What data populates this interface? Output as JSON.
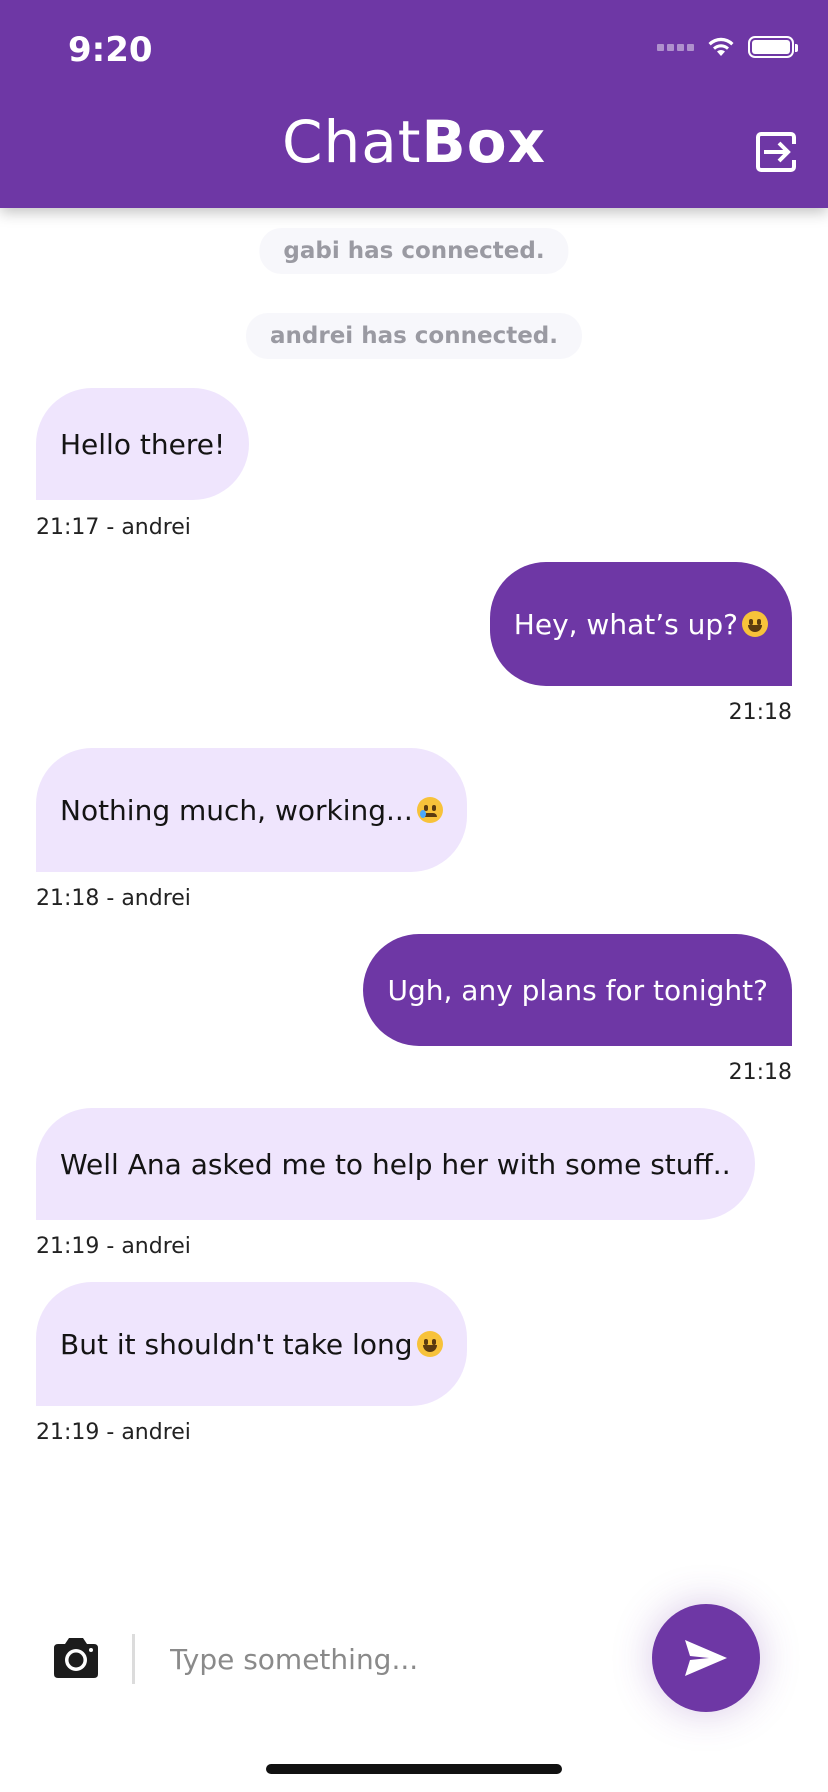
{
  "status_bar": {
    "time": "9:20"
  },
  "header": {
    "title_light": "Chat",
    "title_bold": "Box"
  },
  "system_messages": [
    {
      "text": "gabi has connected."
    },
    {
      "text": "andrei has connected."
    }
  ],
  "messages": [
    {
      "text": "Hello there!",
      "meta": "21:17 - andrei",
      "emoji": null
    },
    {
      "text": "Hey, what’s up?",
      "meta": "21:18",
      "emoji": "grinning-face"
    },
    {
      "text": "Nothing much, working...",
      "meta": "21:18 - andrei",
      "emoji": "crying-face"
    },
    {
      "text": "Ugh, any plans for tonight?",
      "meta": "21:18",
      "emoji": null
    },
    {
      "text": "Well Ana asked me to help her with some stuff..",
      "meta": "21:19 - andrei",
      "emoji": null
    },
    {
      "text": "But it shouldn't take long",
      "meta": "21:19 - andrei",
      "emoji": "beaming-face"
    }
  ],
  "composer": {
    "placeholder": "Type something..."
  },
  "icons": {
    "logout": "logout-icon",
    "camera": "camera-icon",
    "send": "send-icon"
  },
  "colors": {
    "brand": "#6e37a5",
    "incoming_bubble": "#efe5fd"
  }
}
